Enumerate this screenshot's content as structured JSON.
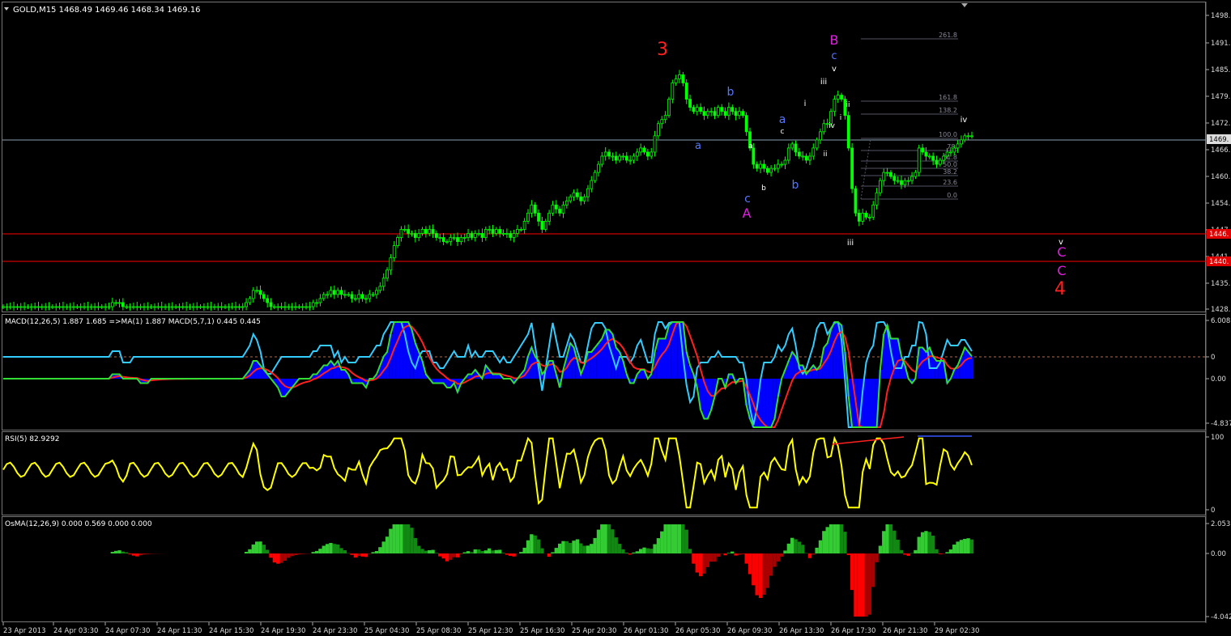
{
  "main": {
    "header": "GOLD,M15  1468.49 1469.46 1468.34 1469.16",
    "price_ticks": [
      "1498.",
      "1491.",
      "1485.",
      "1479.",
      "1472.",
      "1466.",
      "1460.",
      "1454.",
      "1447.",
      "1441.",
      "1435.",
      "1428."
    ],
    "current_price_tag": "1469.",
    "hline_tags": [
      "1446.",
      "1440."
    ],
    "fib_levels": [
      "261.8",
      "161.8",
      "138.2",
      "100.0",
      "78.",
      "61.8",
      "50.0",
      "38.2",
      "23.6",
      "0.0"
    ],
    "wave_labels": {
      "w3": "3",
      "B": "B",
      "A": "A",
      "big4": "4",
      "c_top": "c",
      "v_top": "v",
      "iii_top": "iii",
      "i_1": "i",
      "ii_1": "ii",
      "iv_1": "iv",
      "i_2": "i",
      "ii_2": "ii",
      "a_blue1": "a",
      "b_blue1": "b",
      "a_blue2": "a",
      "b_blue2": "b",
      "c_blue": "c",
      "a_small": "a",
      "b_small": "b",
      "c_small": "c",
      "iii_bottom": "iii",
      "iv_right": "iv",
      "v_right": "v",
      "C1": "C",
      "C2": "C"
    }
  },
  "macd": {
    "header": "MACD(12,26,5) 1.887 1.685  =>MA(1) 1.887  MACD(5,7,1) 0.445 0.445",
    "ticks": [
      "6.008",
      "0",
      "0.00",
      "-4.837"
    ]
  },
  "rsi": {
    "header": "RSI(5) 82.9292",
    "ticks": [
      "100",
      "0"
    ]
  },
  "osma": {
    "header": "OsMA(12,26,9) 0.000 0.569 0.000 0.000",
    "ticks": [
      "2.053",
      "0.00",
      "-4.042"
    ]
  },
  "time_axis": [
    "23 Apr 2013",
    "24 Apr 03:30",
    "24 Apr 07:30",
    "24 Apr 11:30",
    "24 Apr 15:30",
    "24 Apr 19:30",
    "24 Apr 23:30",
    "25 Apr 04:30",
    "25 Apr 08:30",
    "25 Apr 12:30",
    "25 Apr 16:30",
    "25 Apr 20:30",
    "26 Apr 01:30",
    "26 Apr 05:30",
    "26 Apr 09:30",
    "26 Apr 13:30",
    "26 Apr 17:30",
    "26 Apr 21:30",
    "29 Apr 02:30"
  ],
  "colors": {
    "candle": "#00ff00",
    "grid_line": "#3a5a6e",
    "hline": "#ff0000",
    "macd_hist": "#0000ff",
    "macd_cyan": "#33ccff",
    "macd_green": "#33dd33",
    "macd_red": "#ff2020",
    "rsi": "#ffff00",
    "osma_up": "#22cc22",
    "osma_down": "#dd0000"
  },
  "chart_data": [
    {
      "type": "candlestick",
      "title": "GOLD,M15",
      "open": 1468.49,
      "high": 1469.46,
      "low": 1468.34,
      "close": 1469.16,
      "ylim": [
        1426,
        1500
      ],
      "x": [
        "23 Apr 2013",
        "24 Apr 03:30",
        "24 Apr 07:30",
        "24 Apr 11:30",
        "24 Apr 15:30",
        "24 Apr 19:30",
        "24 Apr 23:30",
        "25 Apr 04:30",
        "25 Apr 08:30",
        "25 Apr 12:30",
        "25 Apr 16:30",
        "25 Apr 20:30",
        "26 Apr 01:30",
        "26 Apr 05:30",
        "26 Apr 09:30",
        "26 Apr 13:30",
        "26 Apr 17:30",
        "26 Apr 21:30",
        "29 Apr 02:30"
      ],
      "close_path": [
        1427,
        1427,
        1427,
        1427,
        1427,
        1427,
        1427,
        1427,
        1427,
        1427,
        1427,
        1427,
        1427,
        1427,
        1427,
        1427,
        1427,
        1427,
        1427,
        1427,
        1427,
        1427,
        1427,
        1427,
        1427,
        1427,
        1427,
        1427,
        1427,
        1427,
        1427,
        1428,
        1428,
        1428,
        1427,
        1427,
        1427,
        1427,
        1427,
        1427,
        1427,
        1427,
        1427,
        1427,
        1427,
        1427,
        1427,
        1427,
        1427,
        1427,
        1427,
        1427,
        1427,
        1427,
        1427,
        1427,
        1427,
        1427,
        1427,
        1427,
        1427,
        1427,
        1427,
        1427,
        1427,
        1427,
        1427,
        1427,
        1427,
        1428,
        1429,
        1431,
        1431,
        1430,
        1429,
        1428,
        1427,
        1427,
        1427,
        1427,
        1427,
        1427,
        1427,
        1427,
        1427,
        1427,
        1427,
        1427,
        1428,
        1428,
        1429,
        1430,
        1430,
        1431,
        1430,
        1431,
        1430,
        1430,
        1430,
        1429,
        1429,
        1430,
        1429,
        1429,
        1430,
        1430,
        1431,
        1432,
        1434,
        1436,
        1439,
        1442,
        1444,
        1446,
        1446,
        1445,
        1445,
        1444,
        1445,
        1446,
        1445,
        1446,
        1445,
        1444,
        1444,
        1443,
        1443,
        1444,
        1444,
        1443,
        1444,
        1444,
        1445,
        1444,
        1445,
        1445,
        1444,
        1446,
        1446,
        1445,
        1446,
        1445,
        1445,
        1445,
        1444,
        1445,
        1446,
        1446,
        1448,
        1450,
        1452,
        1450,
        1448,
        1446,
        1448,
        1450,
        1452,
        1451,
        1450,
        1452,
        1453,
        1454,
        1455,
        1454,
        1453,
        1454,
        1456,
        1458,
        1460,
        1462,
        1464,
        1465,
        1464,
        1464,
        1463,
        1464,
        1464,
        1463,
        1463,
        1464,
        1465,
        1466,
        1465,
        1464,
        1465,
        1469,
        1472,
        1473,
        1474,
        1478,
        1482,
        1483,
        1484,
        1482,
        1478,
        1476,
        1475,
        1476,
        1475,
        1474,
        1475,
        1475,
        1474,
        1476,
        1475,
        1474,
        1476,
        1475,
        1474,
        1475,
        1474,
        1470,
        1466,
        1462,
        1461,
        1462,
        1461,
        1460,
        1461,
        1461,
        1462,
        1462,
        1463,
        1466,
        1467,
        1465,
        1464,
        1464,
        1463,
        1464,
        1466,
        1468,
        1470,
        1472,
        1472,
        1475,
        1478,
        1479,
        1478,
        1474,
        1466,
        1456,
        1450,
        1448,
        1450,
        1449,
        1449,
        1452,
        1455,
        1458,
        1460,
        1460,
        1459,
        1458,
        1458,
        1457,
        1458,
        1458,
        1459,
        1460,
        1466,
        1465,
        1464,
        1464,
        1463,
        1462,
        1463,
        1464,
        1465,
        1465,
        1466,
        1467,
        1468,
        1469,
        1469,
        1469
      ]
    },
    {
      "type": "line",
      "title": "MACD(12,26,5)",
      "values": [
        1.887,
        1.685,
        1.887,
        0.445,
        0.445
      ],
      "ylim": [
        -4.837,
        6.008
      ],
      "series": [
        {
          "name": "MACD(12,26,5)",
          "values": [
            1.887
          ]
        },
        {
          "name": "MA(1)",
          "values": [
            1.887
          ]
        },
        {
          "name": "MACD(5,7,1)",
          "values": [
            0.445
          ]
        }
      ]
    },
    {
      "type": "line",
      "title": "RSI(5)",
      "series": [
        {
          "name": "RSI(5)",
          "values": [
            82.9292
          ]
        }
      ],
      "ylim": [
        0,
        100
      ]
    },
    {
      "type": "bar",
      "title": "OsMA(12,26,9)",
      "values": [
        0.0,
        0.569,
        0.0,
        0.0
      ],
      "ylim": [
        -4.042,
        2.053
      ]
    }
  ]
}
